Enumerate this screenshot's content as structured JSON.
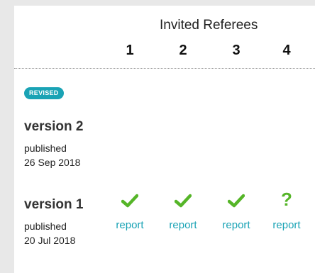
{
  "header": {
    "title": "Invited Referees",
    "referees": [
      "1",
      "2",
      "3",
      "4"
    ]
  },
  "versions": [
    {
      "badge": "REVISED",
      "title": "version 2",
      "published_label": "published",
      "date": "26 Sep 2018"
    },
    {
      "title": "version 1",
      "published_label": "published",
      "date": "20 Jul 2018",
      "reports": [
        {
          "status_icon": "checkmark-icon",
          "link": "report"
        },
        {
          "status_icon": "checkmark-icon",
          "link": "report"
        },
        {
          "status_icon": "checkmark-icon",
          "link": "report"
        },
        {
          "status_icon": "question-mark-icon",
          "symbol": "?",
          "link": "report"
        }
      ]
    }
  ],
  "colors": {
    "accent": "#1aa3b5",
    "approved": "#55b528"
  }
}
